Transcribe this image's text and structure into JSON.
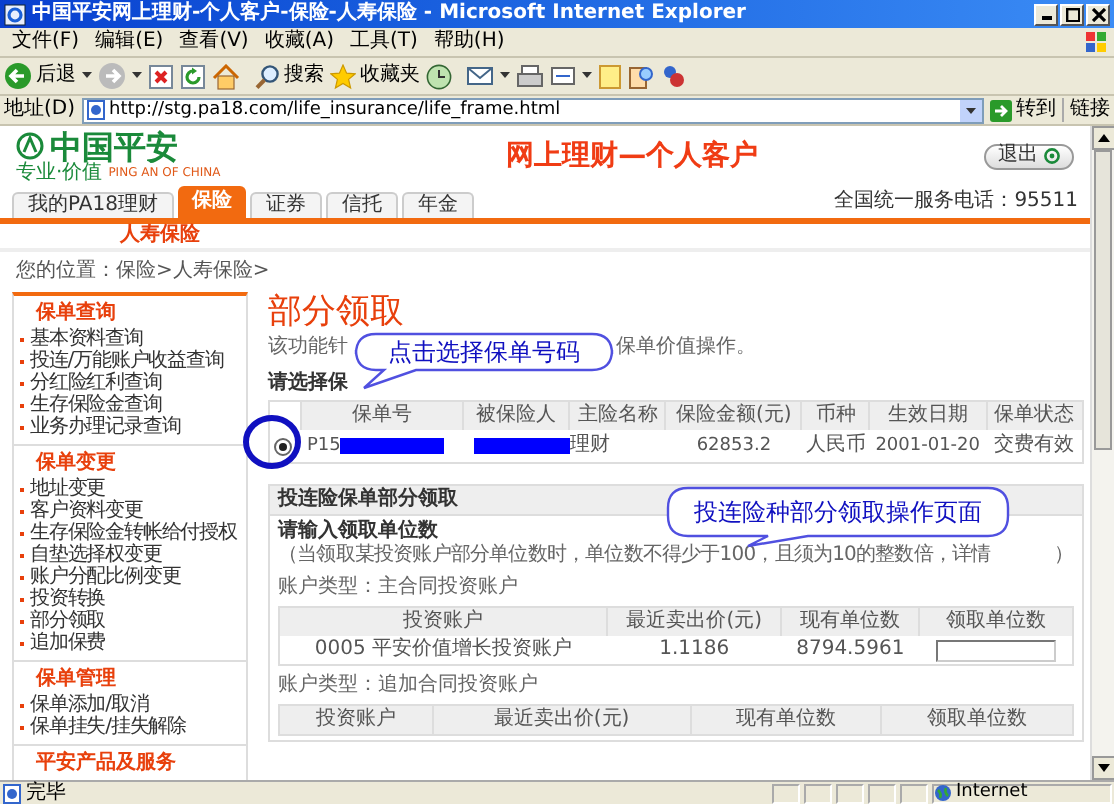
{
  "window": {
    "title": "中国平安网上理财-个人客户-保险-人寿保险 - Microsoft Internet Explorer"
  },
  "menu": [
    "文件(F)",
    "编辑(E)",
    "查看(V)",
    "收藏(A)",
    "工具(T)",
    "帮助(H)"
  ],
  "toolbar": {
    "back": "后退",
    "search": "搜索",
    "favorites": "收藏夹"
  },
  "address_bar": {
    "label": "地址(D)",
    "url": "http://stg.pa18.com/life_insurance/life_frame.html",
    "go": "转到",
    "links": "链接"
  },
  "header": {
    "logo_text": "中国平安",
    "logo_slogan": "专业·价值",
    "logo_english": "PING AN OF CHINA",
    "title": "网上理财—个人客户",
    "logout": "退出",
    "hotline": "全国统一服务电话：95511"
  },
  "tabs": [
    {
      "label": "我的PA18理财",
      "selected": false
    },
    {
      "label": "保险",
      "selected": true
    },
    {
      "label": "证券",
      "selected": false
    },
    {
      "label": "信托",
      "selected": false
    },
    {
      "label": "年金",
      "selected": false
    }
  ],
  "subnav": "人寿保险",
  "breadcrumb": "您的位置：保险>人寿保险>",
  "sidebar": [
    {
      "title": "保单查询",
      "items": [
        "基本资料查询",
        "投连/万能账户收益查询",
        "分红险红利查询",
        "生存保险金查询",
        "业务办理记录查询"
      ]
    },
    {
      "title": "保单变更",
      "items": [
        "地址变更",
        "客户资料变更",
        "生存保险金转帐给付授权",
        "自垫选择权变更",
        "账户分配比例变更",
        "投资转换",
        "部分领取",
        "追加保费"
      ]
    },
    {
      "title": "保单管理",
      "items": [
        "保单添加/取消",
        "保单挂失/挂失解除"
      ]
    },
    {
      "title": "平安产品及服务"
    }
  ],
  "content": {
    "heading": "部分领取",
    "description_start": "该功能针",
    "description_end": "保单价值操作。",
    "select_label": "请选择保"
  },
  "policy_table": {
    "columns": [
      "保单号",
      "被保险人",
      "主险名称",
      "保险金额(元)",
      "币种",
      "生效日期",
      "保单状态"
    ],
    "rows": [
      {
        "selected": true,
        "policy_no": "P15",
        "product": "理财",
        "amount": "62853.2",
        "currency": "人民币",
        "effective_date": "2001-01-20",
        "status": "交费有效"
      }
    ]
  },
  "withdrawal_panel": {
    "title": "投连险保单部分领取",
    "prompt": "请输入领取单位数",
    "note": "（当领取某投资账户部分单位数时，单位数不得少于100，且须为10的整数倍，详情",
    "note_end": "）",
    "sections": [
      {
        "account_type": "账户类型：主合同投资账户",
        "columns": [
          "投资账户",
          "最近卖出价(元)",
          "现有单位数",
          "领取单位数"
        ],
        "rows": [
          {
            "account": "0005 平安价值增长投资账户",
            "price": "1.1186",
            "units": "8794.5961"
          }
        ]
      },
      {
        "account_type": "账户类型：追加合同投资账户",
        "columns": [
          "投资账户",
          "最近卖出价(元)",
          "现有单位数",
          "领取单位数"
        ]
      }
    ]
  },
  "callouts": [
    "点击选择保单号码",
    "投连险种部分领取操作页面"
  ],
  "status_bar": {
    "text": "完毕",
    "zone": "Internet"
  }
}
